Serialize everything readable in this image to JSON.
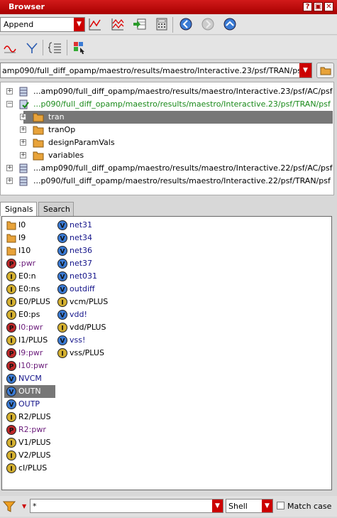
{
  "window": {
    "title": "Browser",
    "help_icon": "?",
    "restore_icon": "▣",
    "close_icon": "✕"
  },
  "toolbar": {
    "mode_value": "Append"
  },
  "path": {
    "value": "amp090/full_diff_opamp/maestro/results/maestro/Interactive.23/psf/TRAN/psf"
  },
  "tree": {
    "items": [
      {
        "label": "...amp090/full_diff_opamp/maestro/results/maestro/Interactive.23/psf/AC/psf",
        "expander": "+"
      },
      {
        "label": "...p090/full_diff_opamp/maestro/results/maestro/Interactive.23/psf/TRAN/psf",
        "expander": "−"
      },
      {
        "label": "tran",
        "expander": "+"
      },
      {
        "label": "tranOp",
        "expander": "+"
      },
      {
        "label": "designParamVals",
        "expander": "+"
      },
      {
        "label": "variables",
        "expander": "+"
      },
      {
        "label": "...amp090/full_diff_opamp/maestro/results/maestro/Interactive.22/psf/AC/psf",
        "expander": "+"
      },
      {
        "label": "...p090/full_diff_opamp/maestro/results/maestro/Interactive.22/psf/TRAN/psf",
        "expander": "+"
      }
    ]
  },
  "tabs": [
    {
      "label": "Signals"
    },
    {
      "label": "Search"
    }
  ],
  "signals": {
    "col1": [
      {
        "label": "I0",
        "kind": "folder"
      },
      {
        "label": "I9",
        "kind": "folder"
      },
      {
        "label": "I10",
        "kind": "folder"
      },
      {
        "label": ":pwr",
        "kind": "power"
      },
      {
        "label": "E0:n",
        "kind": "current"
      },
      {
        "label": "E0:ns",
        "kind": "current"
      },
      {
        "label": "E0/PLUS",
        "kind": "current"
      },
      {
        "label": "E0:ps",
        "kind": "current"
      },
      {
        "label": "I0:pwr",
        "kind": "power"
      },
      {
        "label": "I1/PLUS",
        "kind": "current"
      },
      {
        "label": "I9:pwr",
        "kind": "power"
      },
      {
        "label": "I10:pwr",
        "kind": "power"
      },
      {
        "label": "NVCM",
        "kind": "voltage"
      },
      {
        "label": "OUTN",
        "kind": "voltage"
      },
      {
        "label": "OUTP",
        "kind": "voltage"
      },
      {
        "label": "R2/PLUS",
        "kind": "current"
      },
      {
        "label": "R2:pwr",
        "kind": "power"
      },
      {
        "label": "V1/PLUS",
        "kind": "current"
      },
      {
        "label": "V2/PLUS",
        "kind": "current"
      },
      {
        "label": "cI/PLUS",
        "kind": "current"
      }
    ],
    "col2": [
      {
        "label": "net31",
        "kind": "voltage"
      },
      {
        "label": "net34",
        "kind": "voltage"
      },
      {
        "label": "net36",
        "kind": "voltage"
      },
      {
        "label": "net37",
        "kind": "voltage"
      },
      {
        "label": "net031",
        "kind": "voltage"
      },
      {
        "label": "outdiff",
        "kind": "voltage"
      },
      {
        "label": "vcm/PLUS",
        "kind": "current"
      },
      {
        "label": "vdd!",
        "kind": "voltage"
      },
      {
        "label": "vdd/PLUS",
        "kind": "current"
      },
      {
        "label": "vss!",
        "kind": "voltage"
      },
      {
        "label": "vss/PLUS",
        "kind": "current"
      }
    ]
  },
  "filter": {
    "value": "*",
    "shell_value": "Shell",
    "match_case_label": "Match case"
  },
  "colors": {
    "accent": "#c00000",
    "selection": "#777777",
    "voltage": "#14148a",
    "power": "#6a1b7a",
    "tree_green": "#1a8a1a"
  }
}
